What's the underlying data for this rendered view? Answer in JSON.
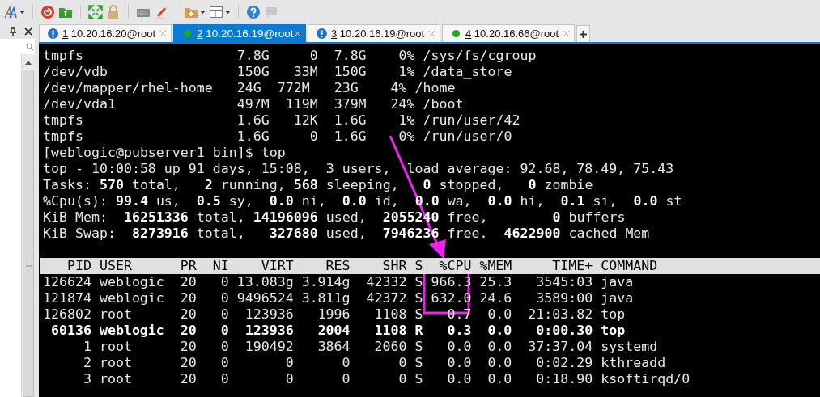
{
  "tabs": [
    {
      "number": "1",
      "title": "10.20.16.20@root",
      "connected": false,
      "selected": false
    },
    {
      "number": "2",
      "title": "10.20.16.19@root",
      "connected": true,
      "selected": true
    },
    {
      "number": "3",
      "title": "10.20.16.19@root",
      "connected": false,
      "selected": false
    },
    {
      "number": "4",
      "title": "10.20.16.66@root",
      "connected": true,
      "selected": false
    }
  ],
  "terminal": {
    "lines": [
      "tmpfs                   7.8G     0  7.8G    0% /sys/fs/cgroup",
      "/dev/vdb                150G   33M  150G    1% /data_store",
      "/dev/mapper/rhel-home   24G  772M   23G    4% /home",
      "/dev/vda1               497M  119M  379M   24% /boot",
      "tmpfs                   1.6G   12K  1.6G    1% /run/user/42",
      "tmpfs                   1.6G     0  1.6G    0% /run/user/0",
      "[weblogic@pubserver1 bin]$ top",
      "top - 10:00:58 up 91 days, 15:08,  3 users,  load average: 92.68, 78.49, 75.43",
      "Tasks: **570** total,   **2** running, **568** sleeping,   **0** stopped,   **0** zombie",
      "%Cpu(s): **99.4** us,  **0.5** sy,  **0.0** ni,  **0.0** id,  **0.0** wa,  **0.0** hi,  **0.1** si,  **0.0** st",
      "KiB Mem:  **16251336** total, **14196096** used,  **2055240** free,        **0** buffers",
      "KiB Swap:  **8273916** total,   **327680** used,  **7946236** free.  **4622900** cached Mem"
    ],
    "process_table": {
      "columns": [
        "PID",
        "USER",
        "PR",
        "NI",
        "VIRT",
        "RES",
        "SHR",
        "S",
        "%CPU",
        "%MEM",
        "TIME+",
        "COMMAND"
      ],
      "rows": [
        {
          "bold": false,
          "cells": [
            "126624",
            "weblogic",
            "20",
            "0",
            "13.083g",
            "3.914g",
            "42332",
            "S",
            "966.3",
            "25.3",
            "3545:03",
            "java"
          ]
        },
        {
          "bold": false,
          "cells": [
            "121874",
            "weblogic",
            "20",
            "0",
            "9496524",
            "3.811g",
            "42372",
            "S",
            "632.0",
            "24.6",
            "3589:00",
            "java"
          ]
        },
        {
          "bold": false,
          "cells": [
            "126802",
            "root",
            "20",
            "0",
            "123936",
            "1996",
            "1108",
            "S",
            "0.7",
            "0.0",
            "21:03.82",
            "top"
          ]
        },
        {
          "bold": true,
          "cells": [
            "60136",
            "weblogic",
            "20",
            "0",
            "123936",
            "2004",
            "1108",
            "R",
            "0.3",
            "0.0",
            "0:00.30",
            "top"
          ]
        },
        {
          "bold": false,
          "cells": [
            "1",
            "root",
            "20",
            "0",
            "190492",
            "3864",
            "2060",
            "S",
            "0.0",
            "0.0",
            "37:37.04",
            "systemd"
          ]
        },
        {
          "bold": false,
          "cells": [
            "2",
            "root",
            "20",
            "0",
            "0",
            "0",
            "0",
            "S",
            "0.0",
            "0.0",
            "0:02.29",
            "kthreadd"
          ]
        },
        {
          "bold": false,
          "cells": [
            "3",
            "root",
            "20",
            "0",
            "0",
            "0",
            "0",
            "S",
            "0.0",
            "0.0",
            "0:18.90",
            "ksoftirqd/0"
          ]
        }
      ]
    }
  }
}
